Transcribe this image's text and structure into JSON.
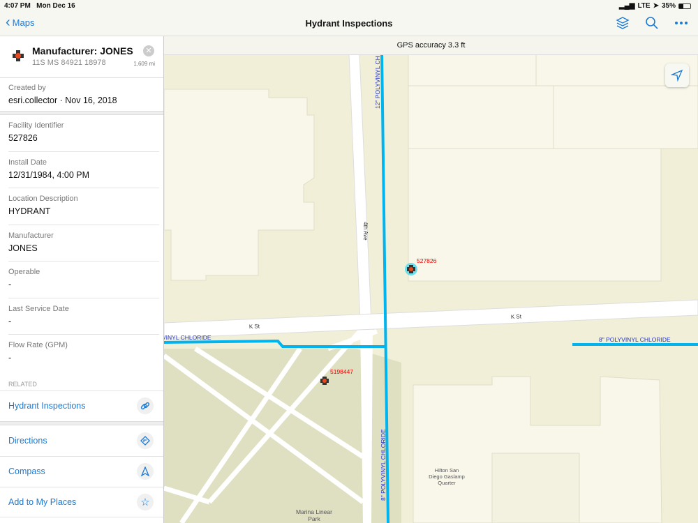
{
  "status": {
    "time": "4:07 PM",
    "date": "Mon Dec 16",
    "network": "LTE",
    "battery": "35%"
  },
  "nav": {
    "back_label": "Maps",
    "title": "Hydrant Inspections",
    "icons": [
      "layers-icon",
      "search-icon",
      "more-icon"
    ]
  },
  "gps": "GPS accuracy 3.3 ft",
  "feature": {
    "title": "Manufacturer: JONES",
    "coords": "11S MS 84921 18978",
    "distance": "1,609 mi"
  },
  "created": {
    "label": "Created by",
    "value": "esri.collector · Nov 16, 2018"
  },
  "fields": [
    {
      "label": "Facility Identifier",
      "value": "527826"
    },
    {
      "label": "Install Date",
      "value": "12/31/1984, 4:00 PM"
    },
    {
      "label": "Location Description",
      "value": "HYDRANT"
    },
    {
      "label": "Manufacturer",
      "value": "JONES"
    },
    {
      "label": "Operable",
      "value": "-"
    },
    {
      "label": "Last Service Date",
      "value": "-"
    },
    {
      "label": "Flow Rate (GPM)",
      "value": "-"
    }
  ],
  "related": {
    "heading": "RELATED",
    "item": "Hydrant Inspections"
  },
  "actions": [
    {
      "label": "Directions"
    },
    {
      "label": "Compass"
    },
    {
      "label": "Add to My Places"
    }
  ],
  "map": {
    "streets": {
      "ave": "4th Ave",
      "k1": "K St",
      "k2": "K St"
    },
    "pipes": {
      "p1": "12\" POLYVINYL CH",
      "p2": "8\" POLYVINYL CHLORIDE",
      "p3": "VINYL CHLORIDE",
      "p4": "8\" POLYVINYL CHLORIDE"
    },
    "hydrants": {
      "h1": "527826",
      "h2": "5198447"
    },
    "poi": {
      "hilton1": "Hilton San",
      "hilton2": "Diego Gaslamp",
      "hilton3": "Quarter",
      "park1": "Marina Linear",
      "park2": "Park"
    },
    "colors": {
      "pipe": "#00b4f0",
      "hydrant": "#e8491d",
      "accent": "#1a7ad6"
    }
  }
}
